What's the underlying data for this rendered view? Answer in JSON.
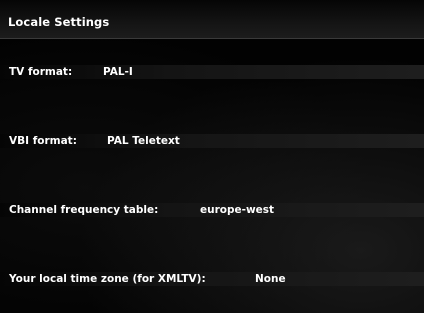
{
  "page": {
    "title": "Locale Settings"
  },
  "settings": [
    {
      "label": "TV format:",
      "value": "PAL-I"
    },
    {
      "label": "VBI format:",
      "value": "PAL Teletext"
    },
    {
      "label": "Channel frequency table:",
      "value": "europe-west"
    },
    {
      "label": "Your local time zone (for XMLTV):",
      "value": "None"
    }
  ],
  "colors": {
    "background": "#020202",
    "text": "#ffffff",
    "row_band": "#1e1e1e"
  }
}
